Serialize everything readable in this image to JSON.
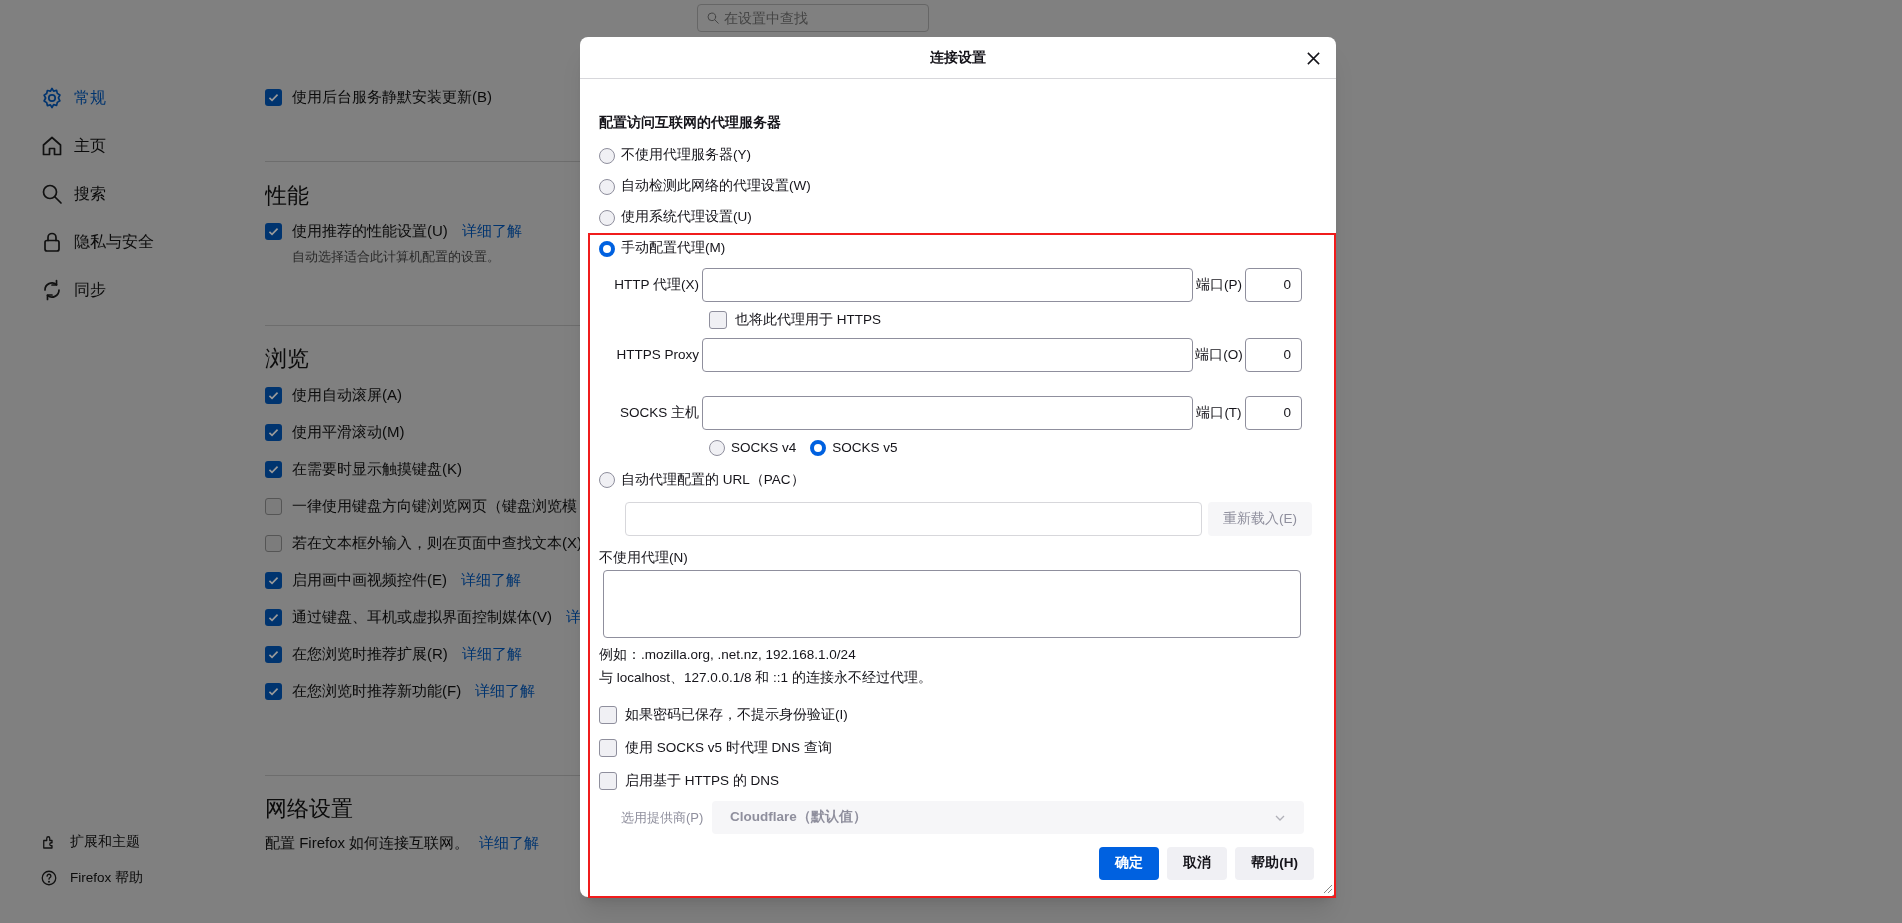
{
  "search": {
    "placeholder": "在设置中查找"
  },
  "sidebar": {
    "items": [
      {
        "kind": "gear",
        "label": "常规",
        "selected": true
      },
      {
        "kind": "home",
        "label": "主页",
        "selected": false
      },
      {
        "kind": "search",
        "label": "搜索",
        "selected": false
      },
      {
        "kind": "lock",
        "label": "隐私与安全",
        "selected": false
      },
      {
        "kind": "sync",
        "label": "同步",
        "selected": false
      }
    ],
    "footer": [
      {
        "kind": "puzzle",
        "label": "扩展和主题"
      },
      {
        "kind": "help",
        "label": "Firefox 帮助"
      }
    ]
  },
  "sections": [
    {
      "rows": [
        {
          "label": "使用后台服务静默安装更新(B)",
          "checked": true
        }
      ]
    },
    {
      "heading": "性能",
      "rows": [
        {
          "label": "使用推荐的性能设置(U)",
          "checked": true,
          "link": "详细了解",
          "description": "自动选择适合此计算机配置的设置。"
        }
      ]
    },
    {
      "heading": "浏览",
      "rows": [
        {
          "label": "使用自动滚屏(A)",
          "checked": true
        },
        {
          "label": "使用平滑滚动(M)",
          "checked": true
        },
        {
          "label": "在需要时显示触摸键盘(K)",
          "checked": true
        },
        {
          "label": "一律使用键盘方向键浏览网页（键盘浏览模",
          "checked": false
        },
        {
          "label": "若在文本框外输入，则在页面中查找文本(X)",
          "checked": false
        },
        {
          "label": "启用画中画视频控件(E)",
          "checked": true,
          "link": "详细了解"
        },
        {
          "label": "通过键盘、耳机或虚拟界面控制媒体(V)",
          "checked": true,
          "link": "详"
        },
        {
          "label": "在您浏览时推荐扩展(R)",
          "checked": true,
          "link": "详细了解"
        },
        {
          "label": "在您浏览时推荐新功能(F)",
          "checked": true,
          "link": "详细了解"
        }
      ]
    },
    {
      "heading": "网络设置",
      "text": "配置 Firefox 如何连接互联网。",
      "link": "详细了解"
    }
  ],
  "dialog": {
    "title": "连接设置",
    "heading": "配置访问互联网的代理服务器",
    "proxy_modes": [
      {
        "label": "不使用代理服务器(Y)",
        "selected": false
      },
      {
        "label": "自动检测此网络的代理设置(W)",
        "selected": false
      },
      {
        "label": "使用系统代理设置(U)",
        "selected": false
      },
      {
        "label": "手动配置代理(M)",
        "selected": true
      }
    ],
    "manual": {
      "fields": [
        {
          "label": "HTTP 代理(X)",
          "port_label": "端口(P)",
          "port": "0"
        },
        {
          "label": "HTTPS Proxy",
          "port_label": "端口(O)",
          "port": "0"
        },
        {
          "label": "SOCKS 主机",
          "port_label": "端口(T)",
          "port": "0"
        }
      ],
      "also_https": {
        "label": "也将此代理用于 HTTPS",
        "checked": false
      },
      "socks_versions": [
        {
          "label": "SOCKS v4",
          "selected": false
        },
        {
          "label": "SOCKS v5",
          "selected": true
        }
      ]
    },
    "pac": {
      "label": "自动代理配置的 URL（PAC）",
      "selected": false,
      "reload_button": "重新载入(E)"
    },
    "no_proxy": {
      "label": "不使用代理(N)",
      "example": "例如：.mozilla.org, .net.nz, 192.168.1.0/24",
      "note": "与 localhost、127.0.0.1/8 和 ::1 的连接永不经过代理。"
    },
    "options": [
      {
        "label": "如果密码已保存，不提示身份验证(I)",
        "checked": false
      },
      {
        "label": "使用 SOCKS v5 时代理 DNS 查询",
        "checked": false
      },
      {
        "label": "启用基于 HTTPS 的 DNS",
        "checked": false
      }
    ],
    "provider": {
      "label": "选用提供商(P)",
      "value": "Cloudflare（默认值）",
      "disabled": true
    },
    "buttons": [
      {
        "label": "确定",
        "kind": "primary"
      },
      {
        "label": "取消",
        "kind": "secondary"
      },
      {
        "label": "帮助(H)",
        "kind": "secondary"
      }
    ]
  }
}
